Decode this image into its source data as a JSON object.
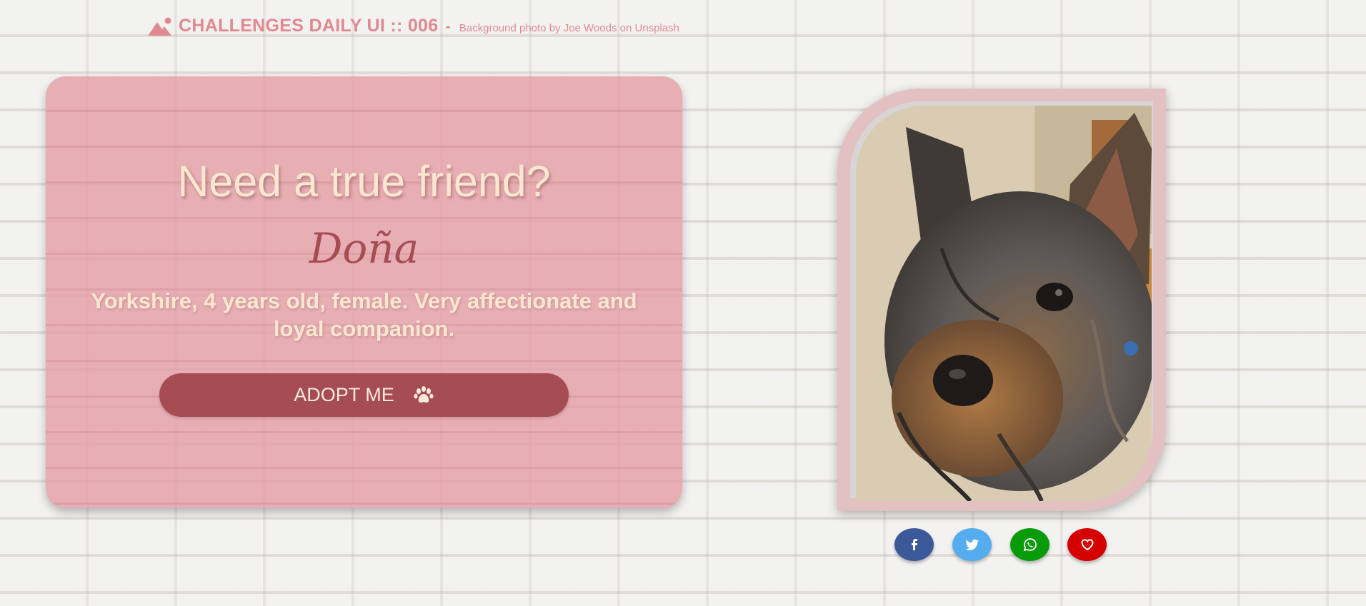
{
  "header": {
    "title": "CHALLENGES DAILY UI :: 006",
    "separator": "-",
    "credit": "Background photo by Joe Woods on Unsplash",
    "logo_icon": "mountain-sun-icon",
    "color": "#e08a90"
  },
  "card": {
    "heading": "Need a true friend?",
    "pet_name": "Doña",
    "description": "Yorkshire, 4 years old, female. Very affectionate and loyal companion.",
    "adopt_button": {
      "label": "ADOPT ME",
      "icon": "paw-icon",
      "color": "#a54d53"
    },
    "background_color": "#e49fa6"
  },
  "photo": {
    "subject_icon": "dog-photo"
  },
  "social": [
    {
      "name": "facebook",
      "icon": "facebook-icon",
      "color": "#3b5998"
    },
    {
      "name": "twitter",
      "icon": "twitter-icon",
      "color": "#55acee"
    },
    {
      "name": "whatsapp",
      "icon": "whatsapp-icon",
      "color": "#0a9b0a"
    },
    {
      "name": "favorite",
      "icon": "heart-icon",
      "color": "#d50000"
    }
  ]
}
